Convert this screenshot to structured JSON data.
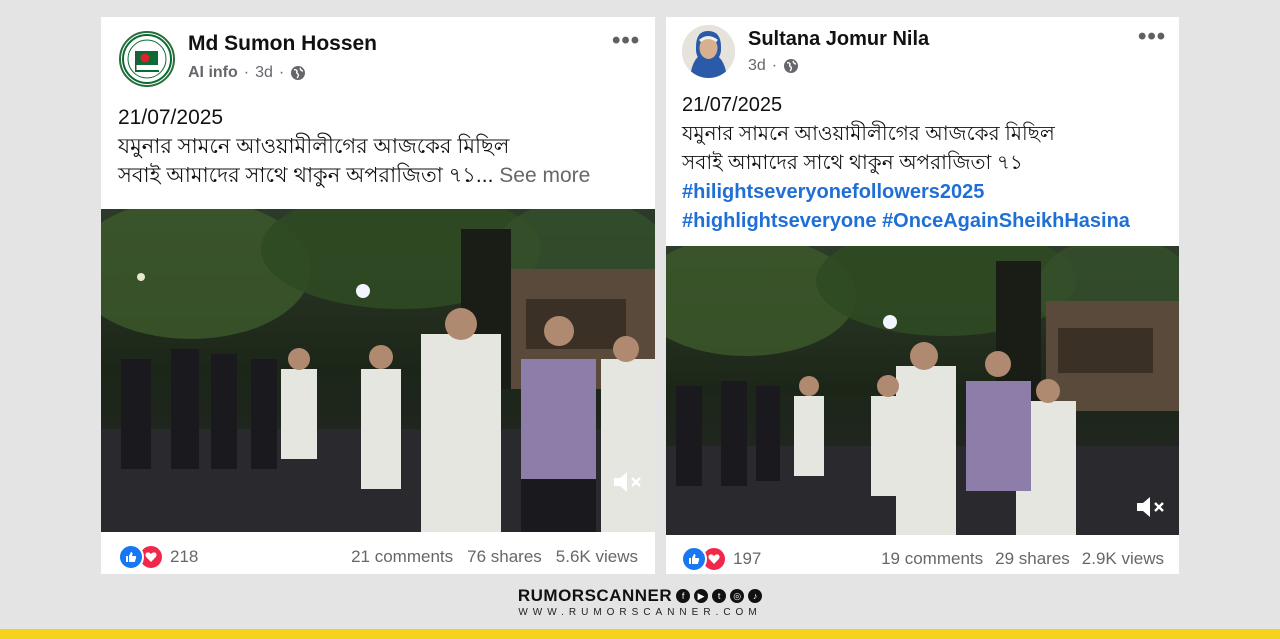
{
  "post_left": {
    "author": "Md Sumon Hossen",
    "tag": "AI info",
    "time": "3d",
    "date": "21/07/2025",
    "line1": "যমুনার সামনে আওয়ামীলীগের আজকের মিছিল",
    "line2": "সবাই আমাদের সাথে থাকুন অপরাজিতা ৭১...",
    "see_more": "See more",
    "reactions": "218",
    "comments": "21 comments",
    "shares": "76 shares",
    "views": "5.6K views"
  },
  "post_right": {
    "author": "Sultana Jomur Nila",
    "time": "3d",
    "date": "21/07/2025",
    "line1": "যমুনার সামনে আওয়ামীলীগের আজকের মিছিল",
    "line2": "সবাই আমাদের সাথে থাকুন অপরাজিতা ৭১",
    "hashtag1": "#hilightseveryonefollowers2025",
    "hashtag2": "#highlightseveryone",
    "hashtag3": "#OnceAgainSheikhHasina",
    "reactions": "197",
    "comments": "19 comments",
    "shares": "29 shares",
    "views": "2.9K views"
  },
  "brand": {
    "name": "RUMORSCANNER",
    "url": "WWW.RUMORSCANNER.COM",
    "social": [
      "f",
      "▶",
      "t",
      "◎",
      "♪"
    ]
  },
  "colors": {
    "accent_blue": "#1877f2",
    "hashtag_blue": "#1f6fd6",
    "love_red": "#f0284a",
    "brand_yellow": "#f6d21a"
  },
  "icons": [
    "more-options-icon",
    "globe-icon",
    "mute-icon",
    "like-icon",
    "love-icon"
  ]
}
